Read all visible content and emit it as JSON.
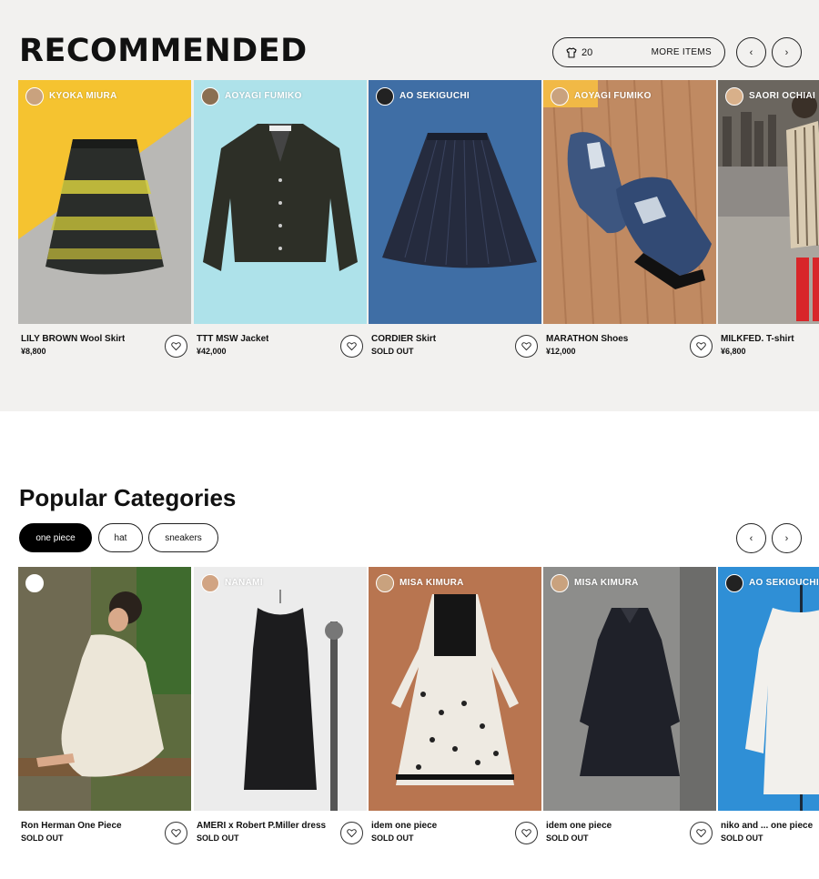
{
  "recommended": {
    "title": "RECOMMENDED",
    "more_count": "20",
    "more_label": "MORE ITEMS",
    "prev_icon": "chevron-left-icon",
    "next_icon": "chevron-right-icon",
    "items": [
      {
        "user": "KYOKA MIURA",
        "name": "LILY BROWN Wool Skirt",
        "price": "¥8,800"
      },
      {
        "user": "AOYAGI FUMIKO",
        "name": "TTT MSW Jacket",
        "price": "¥42,000"
      },
      {
        "user": "AO SEKIGUCHI",
        "name": "CORDIER Skirt",
        "price": "SOLD OUT"
      },
      {
        "user": "AOYAGI FUMIKO",
        "name": "MARATHON Shoes",
        "price": "¥12,000"
      },
      {
        "user": "SAORI OCHIAI",
        "name": "MILKFED. T-shirt",
        "price": "¥6,800"
      }
    ]
  },
  "popular": {
    "title": "Popular Categories",
    "chips": [
      "one piece",
      "hat",
      "sneakers"
    ],
    "active_chip": "one piece",
    "items": [
      {
        "user": "",
        "name": "Ron Herman One Piece",
        "price": "SOLD OUT"
      },
      {
        "user": "NANAMI",
        "name": "AMERI x Robert P.Miller dress",
        "price": "SOLD OUT"
      },
      {
        "user": "MISA KIMURA",
        "name": "idem one piece",
        "price": "SOLD OUT"
      },
      {
        "user": "MISA KIMURA",
        "name": "idem one piece",
        "price": "SOLD OUT"
      },
      {
        "user": "AO SEKIGUCHI",
        "name": "niko and ... one piece",
        "price": "SOLD OUT"
      }
    ]
  },
  "colors": {
    "section_bg": "#f2f1ef",
    "active_chip_bg": "#000000",
    "text": "#111111"
  }
}
